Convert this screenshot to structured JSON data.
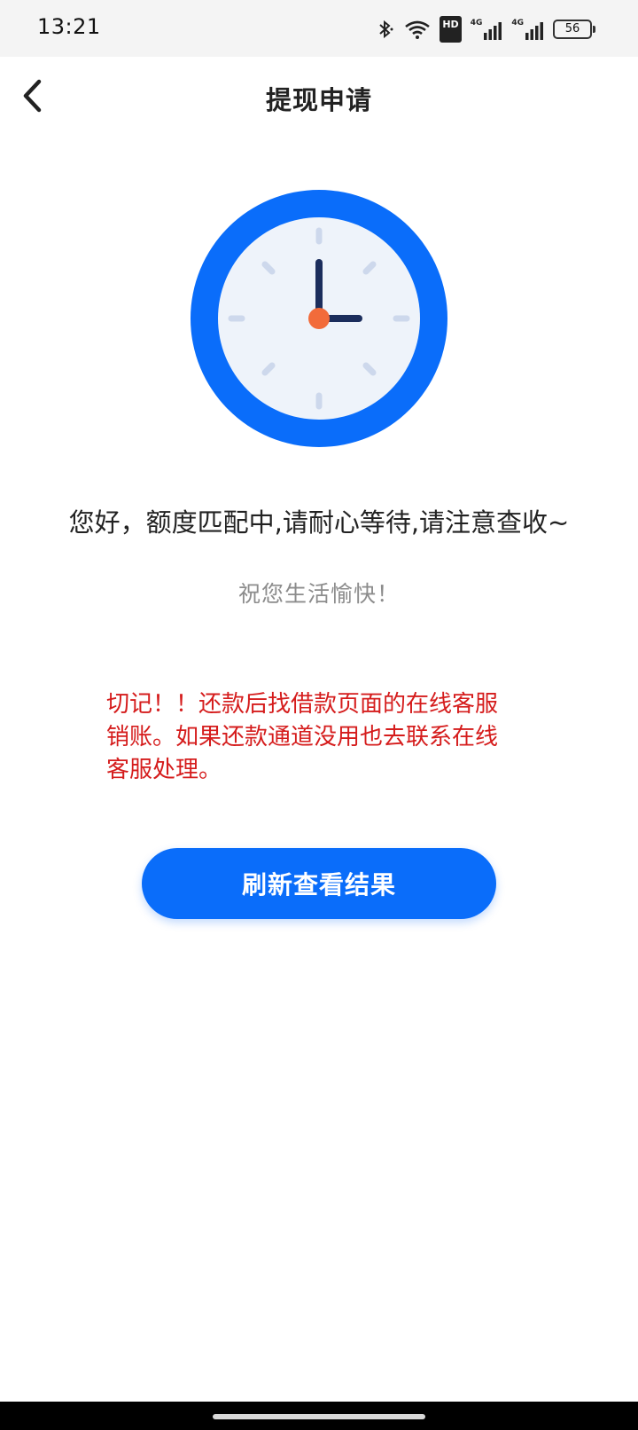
{
  "status_bar": {
    "time": "13:21",
    "hd_label": "HD",
    "net1": "4G",
    "net2": "4G",
    "battery": "56"
  },
  "header": {
    "title": "提现申请",
    "back_icon": "chevron-left-icon"
  },
  "illustration": {
    "icon": "clock-icon",
    "ring_color": "#0a6dfa",
    "face_color": "#eef3fa",
    "hand_color": "#1b2d5c",
    "center_color": "#f26b3a"
  },
  "content": {
    "main_message": "您好，额度匹配中,请耐心等待,请注意查收~",
    "sub_message": "祝您生活愉快！",
    "warning_lines": [
      "切记！！还款后找借款页面的在线客服",
      "销账。如果还款通道没用也去联系在线",
      "客服处理。"
    ],
    "warning_color": "#d51c1c"
  },
  "actions": {
    "refresh_label": "刷新查看结果",
    "accent_color": "#0a6dfa"
  }
}
